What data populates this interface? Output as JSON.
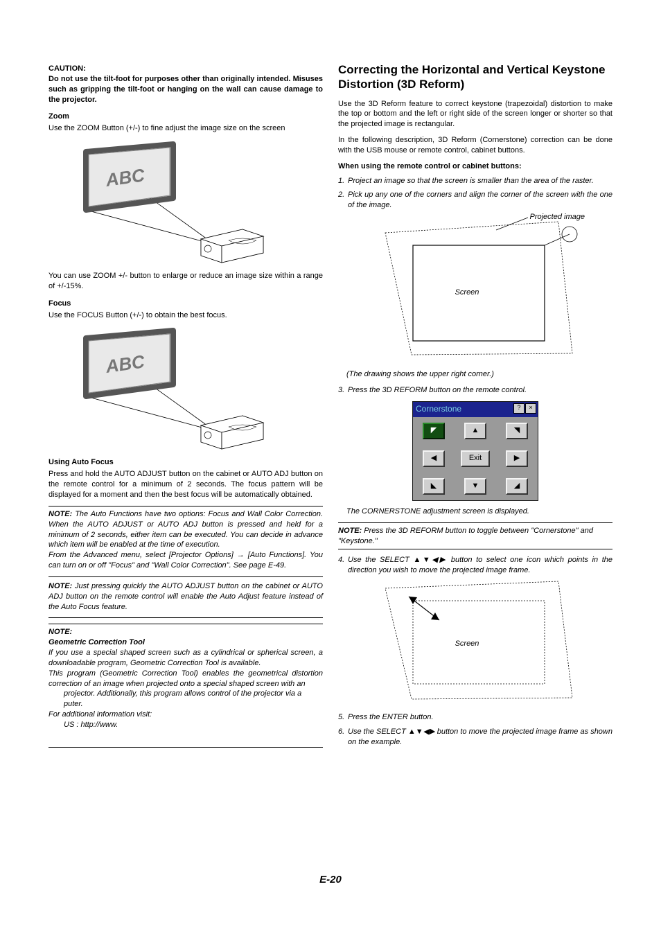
{
  "page_number": "E-20",
  "left": {
    "caution_label": "CAUTION:",
    "caution_text": "Do not use the tilt-foot for purposes other than originally intended. Misuses such as gripping the tilt-foot or hanging on the wall can cause damage to the projector.",
    "zoom_heading": "Zoom",
    "zoom_text1": "Use the ZOOM Button (+/-) to fine adjust the image size on the screen",
    "fig_label_abc1": "ABC",
    "zoom_text2": "You can use ZOOM +/- button to enlarge or reduce an image size within a range of +/-15%.",
    "focus_heading": "Focus",
    "focus_text": "Use the FOCUS Button (+/-) to obtain the best focus.",
    "fig_label_abc2": "ABC",
    "autofocus_heading": "Using Auto Focus",
    "autofocus_text": "Press and hold the AUTO ADJUST button on the cabinet or AUTO ADJ button on the remote control for a minimum of 2 seconds. The focus pattern will be displayed for a moment and then the best focus will be automatically obtained.",
    "note1_label": "NOTE:",
    "note1_text": " The Auto Functions have two options: Focus and Wall Color Correction. When the AUTO ADJUST or AUTO ADJ button is pressed and held for a minimum of 2 seconds, either item can be executed. You can decide in advance which item will be enabled at the time of execution.",
    "note1_text2_a": "From the Advanced menu, select [Projector Options] ",
    "note1_text2_b": " [Auto Functions]. You can turn on or off \"Focus\" and \"Wall Color Correction\". See page E-49.",
    "note2_label": "NOTE:",
    "note2_text": " Just pressing quickly the AUTO ADJUST button on the cabinet or AUTO ADJ button on the remote control will enable the Auto Adjust feature instead of the Auto Focus feature.",
    "note3_label": "NOTE:",
    "note3_heading": "Geometric Correction Tool",
    "note3_text1": "If you use a special shaped screen such as a cylindrical or spherical screen, a downloadable program, Geometric Correction Tool is available.",
    "note3_text2": "This program (Geometric Correction Tool) enables the geometrical distortion correction of an image when projected onto a special shaped screen with an",
    "note3_text3": "projector. Additionally, this program allows control of the projector via a",
    "note3_text3b": "puter.",
    "note3_text4": "For additional information visit:",
    "note3_text5": "US : http://www."
  },
  "right": {
    "heading": "Correcting the Horizontal and Vertical Keystone Distortion (3D Reform)",
    "intro1": "Use the 3D Reform feature to correct keystone (trapezoidal) distortion to make the top or bottom and the left or right side of the screen longer or shorter so that the projected image is rectangular.",
    "intro2": "In the following description, 3D Reform (Cornerstone) correction can be done with the USB mouse or remote control, cabinet buttons.",
    "subhead1": "When using the remote control or cabinet buttons:",
    "step1": "Project an image so that the screen is smaller than the area of the raster.",
    "step2": "Pick up any one of the corners and align the corner of the screen with the one of the image.",
    "projected_label": "Projected image",
    "screen_label1": "Screen",
    "diagram_caption": "(The drawing shows the upper right corner.)",
    "step3": "Press the 3D REFORM button on the remote control.",
    "cs_title": "Cornerstone",
    "cs_exit": "Exit",
    "cs_caption": "The CORNERSTONE adjustment screen is displayed.",
    "note_label": "NOTE:",
    "note_text": " Press the 3D REFORM button to toggle between \"Cornerstone\" and \"Keystone.\"",
    "step4_a": "Use the SELECT ",
    "step4_b": " button to select one icon which points in the direction you wish to move the projected image frame.",
    "screen_label2": "Screen",
    "step5": "Press the ENTER button.",
    "step6_a": "Use the SELECT ",
    "step6_b": " button to move the projected image frame as shown on the example."
  }
}
